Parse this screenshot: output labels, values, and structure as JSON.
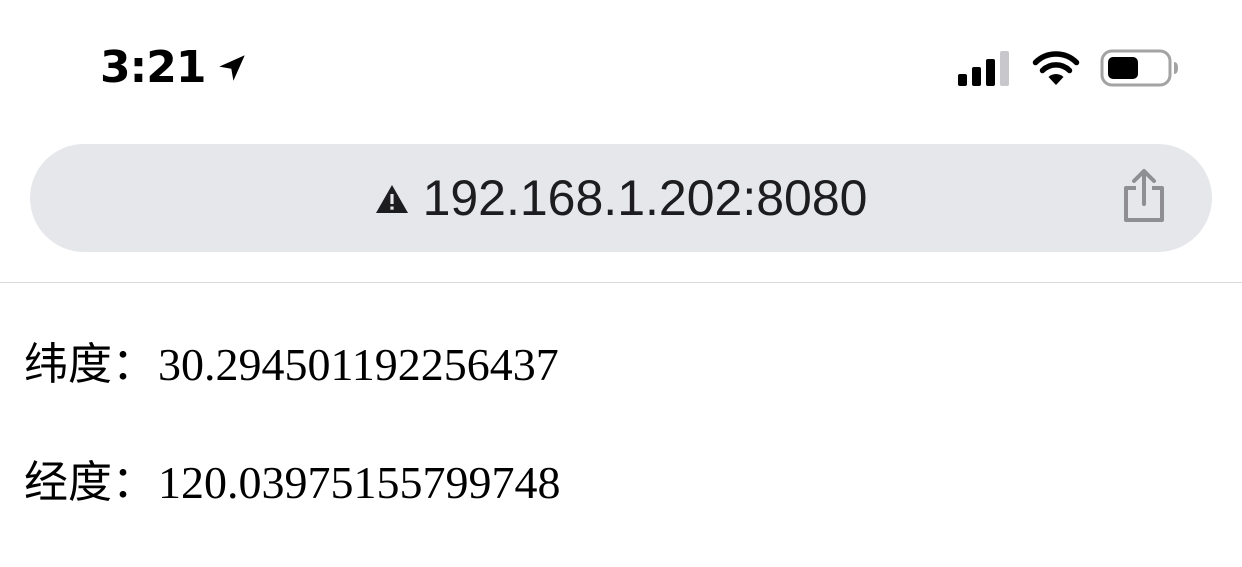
{
  "status_bar": {
    "time": "3:21",
    "icons": [
      "location-arrow-icon",
      "cellular-signal-icon",
      "wifi-icon",
      "battery-icon"
    ]
  },
  "address_bar": {
    "url": "192.168.1.202:8080",
    "icons": [
      "warning-icon",
      "share-icon"
    ]
  },
  "page": {
    "latitude": {
      "label": "纬度：",
      "value": "30.294501192256437"
    },
    "longitude": {
      "label": "经度：",
      "value": "120.03975155799748"
    }
  }
}
